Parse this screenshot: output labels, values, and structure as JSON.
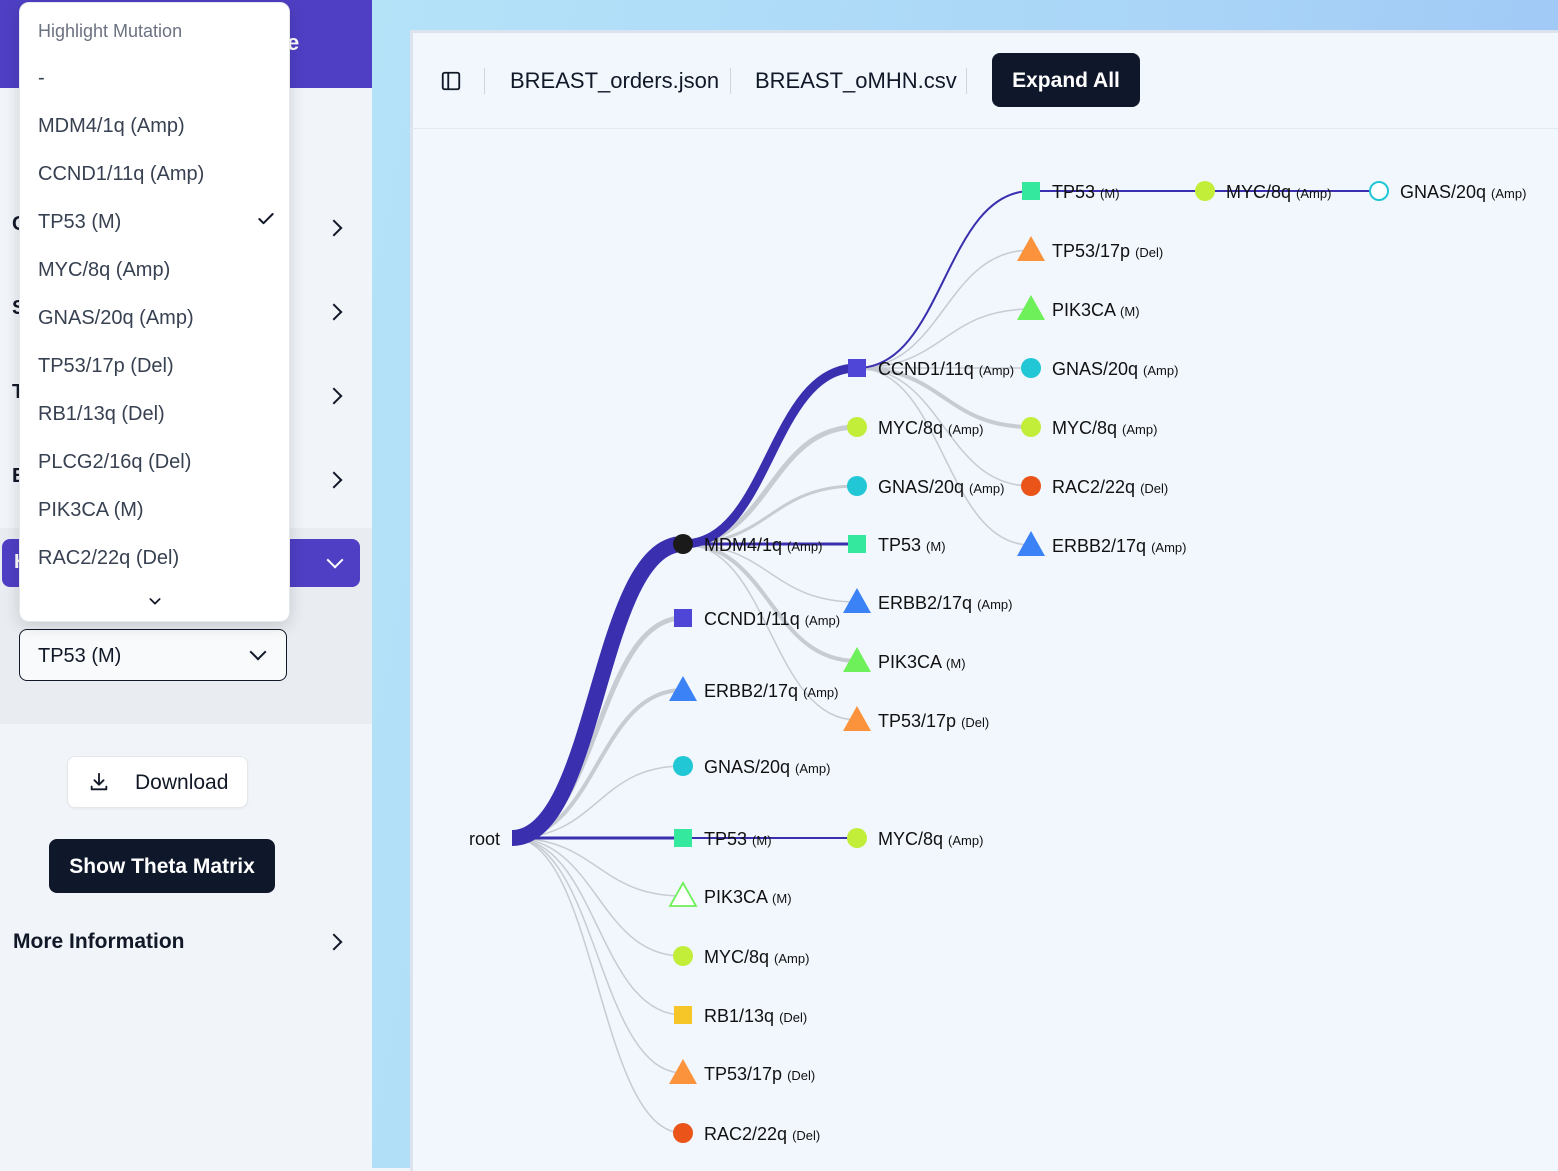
{
  "sidebar": {
    "header_fragment": "e",
    "rows": [
      {
        "label_fragment": "C"
      },
      {
        "label_fragment": "S"
      },
      {
        "label_fragment": "T"
      },
      {
        "label_fragment": "E"
      }
    ],
    "highlight_header_fragment": "H",
    "selected_mutation": "TP53 (M)",
    "download_label": "Download",
    "theta_button_label": "Show Theta Matrix",
    "more_info_label": "More Information"
  },
  "dropdown": {
    "heading": "Highlight Mutation",
    "options": [
      "-",
      "MDM4/1q (Amp)",
      "CCND1/11q (Amp)",
      "TP53 (M)",
      "MYC/8q (Amp)",
      "GNAS/20q (Amp)",
      "TP53/17p (Del)",
      "RB1/13q (Del)",
      "PLCG2/16q (Del)",
      "PIK3CA (M)",
      "RAC2/22q (Del)"
    ],
    "selected_index": 3
  },
  "toolbar": {
    "file1": "BREAST_orders.json",
    "file2": "BREAST_oMHN.csv",
    "expand_label": "Expand All"
  },
  "colors": {
    "accent": "#4f3fc4",
    "highlight_edge": "#3a2fae",
    "dark_button": "#0f172a",
    "MDM4": "#1a1a1a",
    "CCND1": "#4f46d8",
    "TP53": "#34e89e",
    "MYC": "#c2ee3a",
    "GNAS": "#22c7d6",
    "TP53_17p": "#fb923c",
    "PIK3CA": "#6ef05a",
    "ERBB2": "#3b82f6",
    "RB1": "#f6c629",
    "RAC2": "#ea5418"
  },
  "tree": {
    "root_label": "root",
    "nodes": [
      {
        "id": "mdm4",
        "name": "MDM4/1q",
        "tag": "(Amp)",
        "shape": "circle",
        "color": "MDM4"
      },
      {
        "id": "ccnd1_a",
        "name": "CCND1/11q",
        "tag": "(Amp)",
        "shape": "square",
        "color": "CCND1"
      },
      {
        "id": "erbb2_a",
        "name": "ERBB2/17q",
        "tag": "(Amp)",
        "shape": "triangle",
        "color": "ERBB2"
      },
      {
        "id": "gnas_a",
        "name": "GNAS/20q",
        "tag": "(Amp)",
        "shape": "circle",
        "color": "GNAS"
      },
      {
        "id": "tp53_a",
        "name": "TP53",
        "tag": "(M)",
        "shape": "square",
        "color": "TP53"
      },
      {
        "id": "pik3ca_a",
        "name": "PIK3CA",
        "tag": "(M)",
        "shape": "triangle-outline",
        "color": "PIK3CA"
      },
      {
        "id": "myc_a",
        "name": "MYC/8q",
        "tag": "(Amp)",
        "shape": "circle",
        "color": "MYC"
      },
      {
        "id": "rb1_a",
        "name": "RB1/13q",
        "tag": "(Del)",
        "shape": "square",
        "color": "RB1"
      },
      {
        "id": "tp5317p_a",
        "name": "TP53/17p",
        "tag": "(Del)",
        "shape": "triangle",
        "color": "TP53_17p"
      },
      {
        "id": "rac2_a",
        "name": "RAC2/22q",
        "tag": "(Del)",
        "shape": "circle",
        "color": "RAC2"
      },
      {
        "id": "ccnd1_b",
        "name": "CCND1/11q",
        "tag": "(Amp)",
        "shape": "square",
        "color": "CCND1"
      },
      {
        "id": "myc_b",
        "name": "MYC/8q",
        "tag": "(Amp)",
        "shape": "circle",
        "color": "MYC"
      },
      {
        "id": "gnas_b",
        "name": "GNAS/20q",
        "tag": "(Amp)",
        "shape": "circle",
        "color": "GNAS"
      },
      {
        "id": "tp53_b",
        "name": "TP53",
        "tag": "(M)",
        "shape": "square",
        "color": "TP53"
      },
      {
        "id": "erbb2_b",
        "name": "ERBB2/17q",
        "tag": "(Amp)",
        "shape": "triangle",
        "color": "ERBB2"
      },
      {
        "id": "pik3ca_b",
        "name": "PIK3CA",
        "tag": "(M)",
        "shape": "triangle",
        "color": "PIK3CA"
      },
      {
        "id": "tp5317p_b",
        "name": "TP53/17p",
        "tag": "(Del)",
        "shape": "triangle",
        "color": "TP53_17p"
      },
      {
        "id": "myc_c",
        "name": "MYC/8q",
        "tag": "(Amp)",
        "shape": "circle",
        "color": "MYC"
      },
      {
        "id": "tp53_c",
        "name": "TP53",
        "tag": "(M)",
        "shape": "square",
        "color": "TP53"
      },
      {
        "id": "tp5317p_c",
        "name": "TP53/17p",
        "tag": "(Del)",
        "shape": "triangle",
        "color": "TP53_17p"
      },
      {
        "id": "pik3ca_c",
        "name": "PIK3CA",
        "tag": "(M)",
        "shape": "triangle",
        "color": "PIK3CA"
      },
      {
        "id": "gnas_c",
        "name": "GNAS/20q",
        "tag": "(Amp)",
        "shape": "circle",
        "color": "GNAS"
      },
      {
        "id": "myc_d",
        "name": "MYC/8q",
        "tag": "(Amp)",
        "shape": "circle",
        "color": "MYC"
      },
      {
        "id": "rac2_c",
        "name": "RAC2/22q",
        "tag": "(Del)",
        "shape": "circle",
        "color": "RAC2"
      },
      {
        "id": "erbb2_c",
        "name": "ERBB2/17q",
        "tag": "(Amp)",
        "shape": "triangle",
        "color": "ERBB2"
      },
      {
        "id": "myc_e",
        "name": "MYC/8q",
        "tag": "(Amp)",
        "shape": "circle",
        "color": "MYC"
      },
      {
        "id": "gnas_d",
        "name": "GNAS/20q",
        "tag": "(Amp)",
        "shape": "circle-outline",
        "color": "GNAS"
      }
    ],
    "edges": [
      {
        "from": "root",
        "to": "mdm4",
        "highlight": true
      },
      {
        "from": "root",
        "to": "ccnd1_a"
      },
      {
        "from": "root",
        "to": "erbb2_a"
      },
      {
        "from": "root",
        "to": "gnas_a"
      },
      {
        "from": "root",
        "to": "tp53_a",
        "highlight": true
      },
      {
        "from": "root",
        "to": "pik3ca_a"
      },
      {
        "from": "root",
        "to": "myc_a"
      },
      {
        "from": "root",
        "to": "rb1_a"
      },
      {
        "from": "root",
        "to": "tp5317p_a"
      },
      {
        "from": "root",
        "to": "rac2_a"
      },
      {
        "from": "mdm4",
        "to": "ccnd1_b",
        "highlight": true
      },
      {
        "from": "mdm4",
        "to": "myc_b"
      },
      {
        "from": "mdm4",
        "to": "gnas_b"
      },
      {
        "from": "mdm4",
        "to": "tp53_b",
        "highlight": true
      },
      {
        "from": "mdm4",
        "to": "erbb2_b"
      },
      {
        "from": "mdm4",
        "to": "pik3ca_b"
      },
      {
        "from": "mdm4",
        "to": "tp5317p_b"
      },
      {
        "from": "tp53_a",
        "to": "myc_c",
        "highlight": true
      },
      {
        "from": "ccnd1_b",
        "to": "tp53_c",
        "highlight": true
      },
      {
        "from": "ccnd1_b",
        "to": "tp5317p_c"
      },
      {
        "from": "ccnd1_b",
        "to": "pik3ca_c"
      },
      {
        "from": "ccnd1_b",
        "to": "gnas_c"
      },
      {
        "from": "ccnd1_b",
        "to": "myc_d"
      },
      {
        "from": "ccnd1_b",
        "to": "rac2_c"
      },
      {
        "from": "ccnd1_b",
        "to": "erbb2_c"
      },
      {
        "from": "tp53_c",
        "to": "myc_e",
        "highlight": true
      },
      {
        "from": "myc_e",
        "to": "gnas_d",
        "highlight": true
      }
    ]
  }
}
